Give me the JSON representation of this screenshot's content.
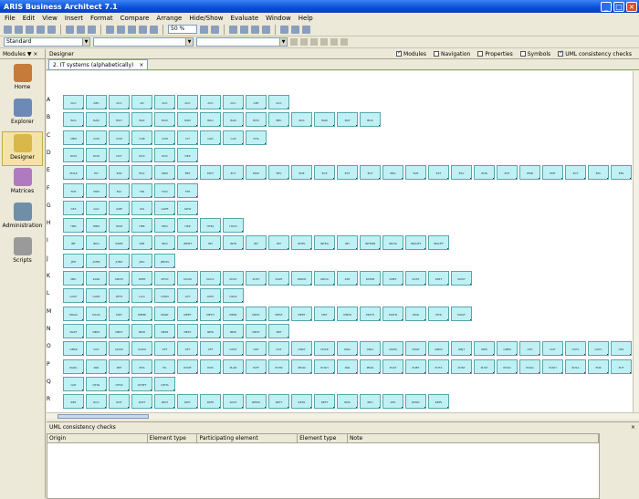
{
  "window": {
    "title": "ARIS Business Architect 7.1"
  },
  "menu": [
    "File",
    "Edit",
    "View",
    "Insert",
    "Format",
    "Compare",
    "Arrange",
    "Hide/Show",
    "Evaluate",
    "Window",
    "Help"
  ],
  "toolbar": {
    "zoom": "50 %"
  },
  "format": {
    "style": "Standard"
  },
  "modules": {
    "label": "Modules",
    "items": [
      "Home",
      "Explorer",
      "Designer",
      "Matrices",
      "Administration",
      "Scripts"
    ],
    "selected": "Designer"
  },
  "designer": {
    "label": "Designer",
    "tab": "2. IT systems (alphabetically)",
    "checks": [
      {
        "label": "Modules",
        "on": true
      },
      {
        "label": "Navigation",
        "on": false
      },
      {
        "label": "Properties",
        "on": false
      },
      {
        "label": "Symbols",
        "on": false
      },
      {
        "label": "UML consistency checks",
        "on": true
      }
    ]
  },
  "rows": [
    {
      "letter": "A",
      "items": [
        "ACC",
        "ABC",
        "ACC",
        "AD",
        "ACC",
        "ACC",
        "ACC",
        "ACC",
        "APP",
        "ACC"
      ]
    },
    {
      "letter": "B",
      "items": [
        "BAS",
        "BAN",
        "BCH",
        "BCK",
        "BUD",
        "BAN",
        "BAU",
        "BAN",
        "BHS",
        "BEC",
        "BAS",
        "BAN",
        "BAT",
        "BUD"
      ]
    },
    {
      "letter": "C",
      "items": [
        "CBM",
        "CCM",
        "CCM",
        "CAB",
        "CCM",
        "CIT",
        "CAD",
        "CAP",
        "CHA"
      ]
    },
    {
      "letter": "D",
      "items": [
        "DCM",
        "DCM",
        "DCT",
        "DOC",
        "DOC",
        "DEP"
      ]
    },
    {
      "letter": "E",
      "items": [
        "EDAP",
        "EIT",
        "EAP",
        "EDC",
        "ERM",
        "EBT",
        "EDIT",
        "ECT",
        "EDM",
        "EEV",
        "EDE",
        "ECP",
        "EST",
        "ECF",
        "EBA",
        "EVE",
        "EXT",
        "ESV",
        "EDB",
        "EST",
        "EMB",
        "EMT",
        "ECT",
        "EPC",
        "EPS"
      ]
    },
    {
      "letter": "F",
      "items": [
        "FNT",
        "FRM",
        "FAC",
        "FIN",
        "FOO",
        "FTP"
      ]
    },
    {
      "letter": "G",
      "items": [
        "GFX",
        "GLO",
        "GMP",
        "GIS",
        "GATE",
        "GDW"
      ]
    },
    {
      "letter": "H",
      "items": [
        "HBC",
        "HBM",
        "HDM",
        "HER",
        "HRD",
        "HRP",
        "HTBL",
        "HOTA"
      ]
    },
    {
      "letter": "I",
      "items": [
        "IBF",
        "IBCC",
        "INDM",
        "INM",
        "INCC",
        "IDENT",
        "INT",
        "INTR",
        "INT",
        "INT",
        "INTEL",
        "INTEG",
        "INT",
        "INTERN",
        "INSTA",
        "INQUET",
        "INSUFF"
      ]
    },
    {
      "letter": "J",
      "items": [
        "JDH",
        "JOHN",
        "JUNO",
        "JIRA",
        "JBOSS"
      ]
    },
    {
      "letter": "K",
      "items": [
        "KBC",
        "KAPA",
        "KBCM",
        "KEEP",
        "KEYD",
        "KCON",
        "KOCC",
        "KOST",
        "KUST",
        "KART",
        "KNOW",
        "KRUG",
        "KSP",
        "KOMM",
        "KNET",
        "KOST",
        "KSET",
        "KOOT"
      ]
    },
    {
      "letter": "L",
      "items": [
        "LOGT",
        "LANS",
        "LBTS",
        "LILA",
        "LEGN",
        "LOT",
        "LUEX",
        "LNGS"
      ]
    },
    {
      "letter": "M",
      "items": [
        "MOAS",
        "MCAS",
        "MDT",
        "MEME",
        "MART",
        "MEET",
        "METH",
        "MERC",
        "MKST",
        "MEST",
        "MEET",
        "MST",
        "MNTR",
        "MOTH",
        "MOTN",
        "MOR",
        "MTR",
        "MGST"
      ]
    },
    {
      "letter": "N",
      "items": [
        "NAPT",
        "NBST",
        "NBCT",
        "NEIR",
        "NESE",
        "NEST",
        "NEW",
        "NERI",
        "NEXT",
        "NET"
      ]
    },
    {
      "letter": "O",
      "items": [
        "OBSP",
        "OCC",
        "OCRD",
        "OCRO",
        "OFF",
        "OFT",
        "OFF",
        "OKST",
        "OKT",
        "OUT",
        "ONST",
        "OHCE",
        "ONLI",
        "ONLY",
        "ONHS",
        "ORGT",
        "OBDC",
        "OBJT",
        "OEPI",
        "OPEN",
        "OST",
        "OUT",
        "OUTL",
        "OUTL",
        "OPL"
      ]
    },
    {
      "letter": "P",
      "items": [
        "PAWL",
        "PAR",
        "PRT",
        "PHA",
        "PIL",
        "PCMT",
        "PLTS",
        "PLAN",
        "PLTT",
        "PUTN",
        "PEAN",
        "PUSH",
        "PAR",
        "PEAR",
        "PUAT",
        "PUBT",
        "PUTX",
        "PUSP",
        "PUST",
        "PUSO",
        "PUSQ",
        "PUSH",
        "PUSA",
        "PUR",
        "PUT"
      ]
    },
    {
      "letter": "Q",
      "items": [
        "QAT",
        "QTRL",
        "QTCR",
        "QTSET",
        "QTHA"
      ]
    },
    {
      "letter": "R",
      "items": [
        "RBT",
        "RCO",
        "RDT",
        "RSFT",
        "RELT",
        "REIT",
        "RSFE",
        "RAST",
        "REMO",
        "RETT",
        "RETR",
        "REFT",
        "RMS",
        "REV",
        "RFS",
        "RMGT",
        "REPS"
      ]
    }
  ],
  "uml": {
    "title": "UML consistency checks",
    "columns": [
      "Origin",
      "Element type",
      "Participating element",
      "Element type",
      "Note"
    ]
  }
}
